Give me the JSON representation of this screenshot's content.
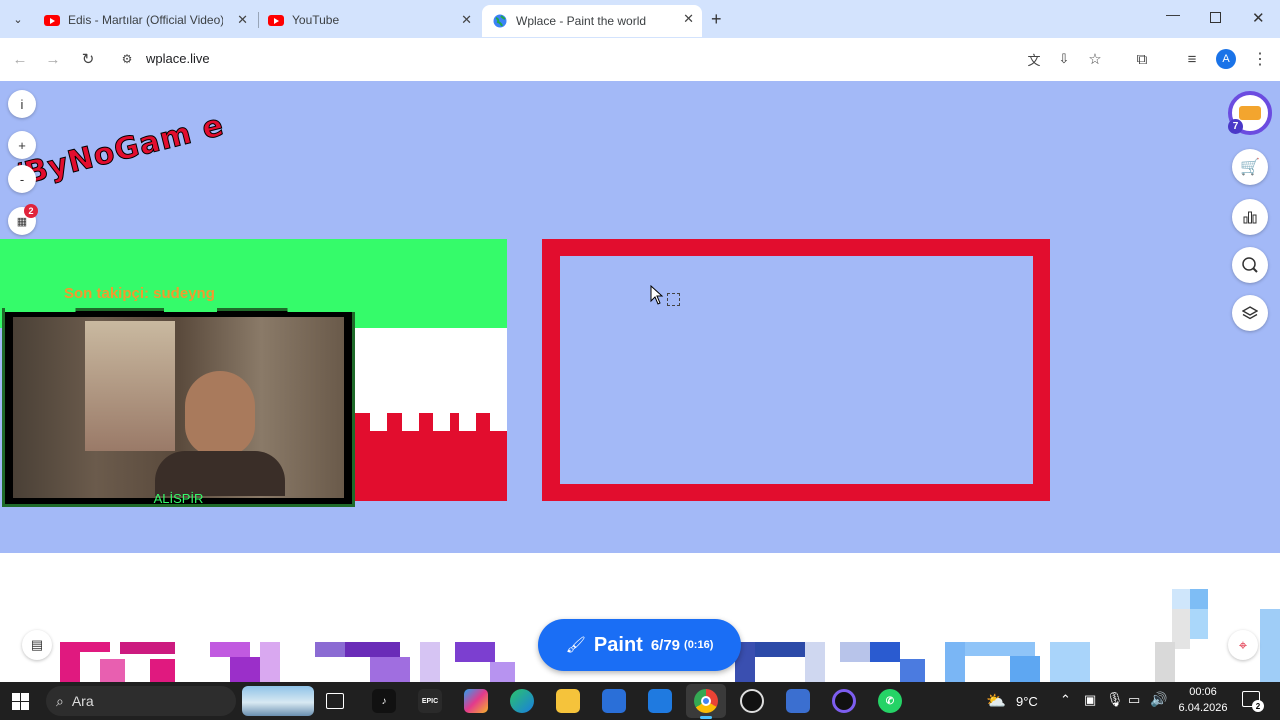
{
  "browser": {
    "tabs": [
      {
        "title": "Edis - Martılar (Official Video) -",
        "active": false
      },
      {
        "title": "YouTube",
        "active": false
      },
      {
        "title": "Wplace - Paint the world",
        "active": true
      }
    ],
    "url": "wplace.live",
    "profile_initial": "A"
  },
  "canvas": {
    "left_controls": [
      "i",
      "+",
      "-"
    ],
    "notif_count": "2",
    "overlay_logo_text": "/ByNoGam e",
    "follower_text": "Son takipçi: sudeyng",
    "webcam_name": "ALİSPİR",
    "level_badge": "7"
  },
  "paint_button": {
    "label": "Paint",
    "count": "6/79",
    "timer": "(0:16)",
    "color": "#1a6ef5"
  },
  "colors": {
    "sky": "#a3b9f7",
    "green": "#35fb6a",
    "red": "#e20d2e",
    "white": "#ffffff"
  },
  "taskbar": {
    "search_placeholder": "Ara",
    "weather": "9°C",
    "time": "00:06",
    "date": "6.04.2026",
    "notif_badge": "2"
  }
}
